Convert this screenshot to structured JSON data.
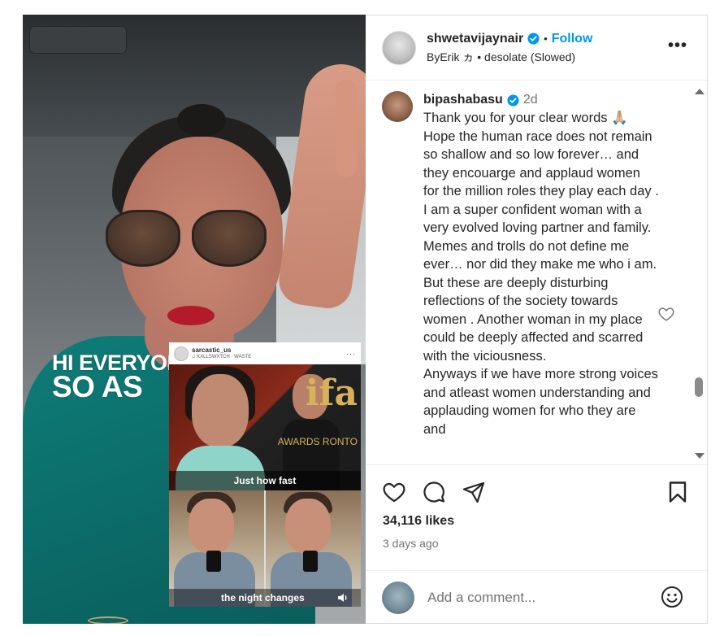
{
  "media": {
    "overlay_line1": "HI EVERYONE",
    "overlay_line2": "SO AS",
    "embedded_post": {
      "username": "sarcastic_us",
      "song": "♫ KXLLSWXTCH · WASTE",
      "sign_text": "ifa",
      "sign_sub": "AWARDS RONTO",
      "caption_top": "Just how fast",
      "caption_bottom": "the night changes",
      "sound_icon": "speaker-icon"
    }
  },
  "header": {
    "username": "shwetavijaynair",
    "verified": true,
    "separator": "•",
    "follow_label": "Follow",
    "song_artist": "ByErik ヵ",
    "song_title": "desolate (Slowed)",
    "more_label": "•••"
  },
  "comment": {
    "username": "bipashabasu",
    "verified": true,
    "time": "2d",
    "text": "Thank you for your clear words 🙏🏼\nHope the human race does not remain so shallow and so low forever… and they encouarge and applaud women for the million roles they play each day .\nI am a super confident woman with a very evolved loving partner and family. Memes and trolls do not define me ever… nor did they make me who i am. But these are deeply disturbing reflections of the society towards women . Another woman in my place could be deeply affected and scarred with the viciousness.\nAnyways if we have more strong voices and atleast women understanding and applauding women for who they are and"
  },
  "actions": {
    "like_icon": "heart-icon",
    "comment_icon": "comment-icon",
    "share_icon": "share-icon",
    "save_icon": "bookmark-icon",
    "likes": "34,116 likes",
    "time_ago": "3 days ago"
  },
  "add_comment": {
    "placeholder": "Add a comment...",
    "emoji_icon": "emoji-icon"
  },
  "colors": {
    "accent": "#0095f6",
    "verified": "#0095f6",
    "muted": "#737373",
    "text": "#262626"
  }
}
